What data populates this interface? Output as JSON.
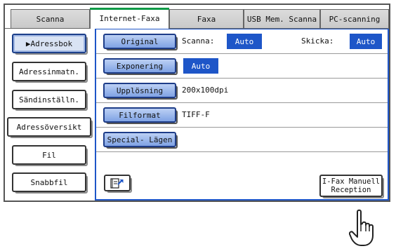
{
  "tabs": [
    {
      "label": "Scanna",
      "active": false
    },
    {
      "label": "Internet-Faxa",
      "active": true
    },
    {
      "label": "Faxa",
      "active": false
    },
    {
      "label": "USB Mem. Scanna",
      "active": false
    },
    {
      "label": "PC-scanning",
      "active": false
    }
  ],
  "left_buttons": {
    "adressbok": "▶Adressbok",
    "adressinmatn": "Adressinmatn.",
    "sandinstalln": "Sändinställn.",
    "adressoversikt": "Adressöversikt",
    "fil": "Fil",
    "snabbfil": "Snabbfil"
  },
  "settings": {
    "original": {
      "label": "Original",
      "scan_label": "Scanna:",
      "scan_value": "Auto",
      "send_label": "Skicka:",
      "send_value": "Auto"
    },
    "exponering": {
      "label": "Exponering",
      "value": "Auto"
    },
    "upplosning": {
      "label": "Upplösning",
      "value": "200x100dpi"
    },
    "filformat": {
      "label": "Filformat",
      "value": "TIFF-F"
    },
    "special": {
      "label": "Special- Lägen"
    }
  },
  "ifax_button": {
    "line1": "I-Fax Manuell",
    "line2": "Reception"
  },
  "colors": {
    "accent": "#1e56c8",
    "active_tab_marker": "#0a9a46"
  }
}
